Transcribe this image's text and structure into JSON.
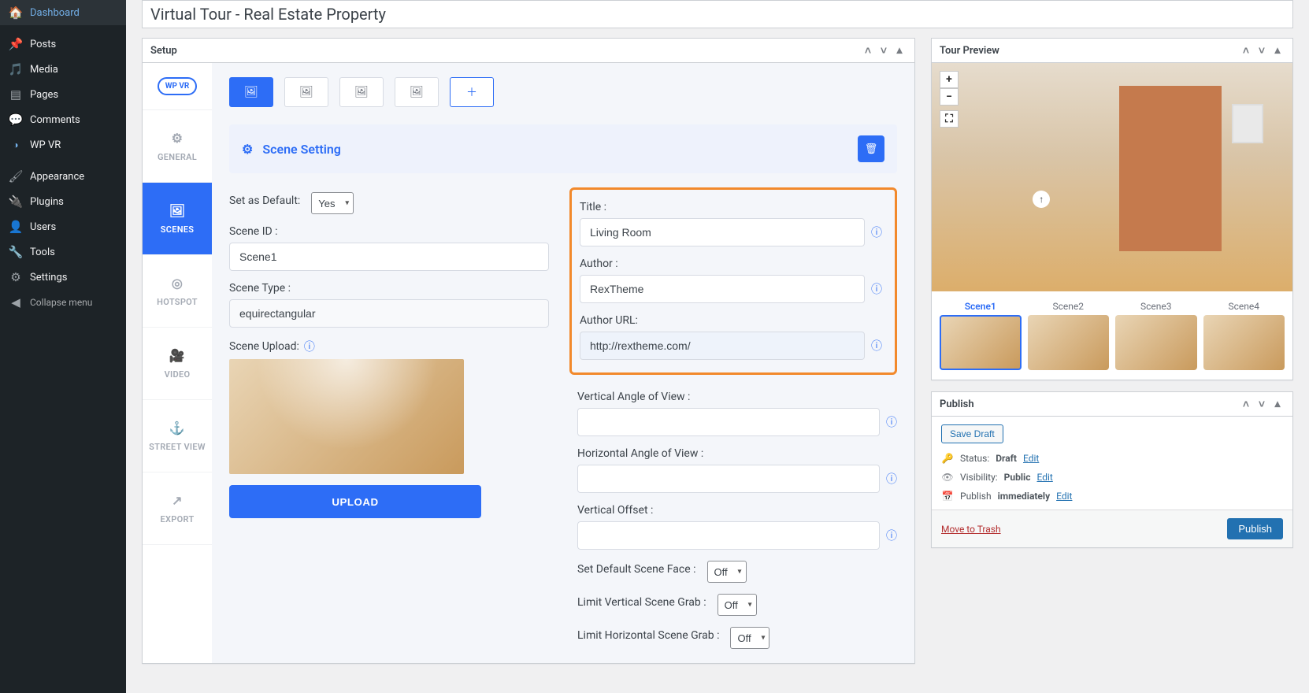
{
  "admin_menu": {
    "dashboard": "Dashboard",
    "posts": "Posts",
    "media": "Media",
    "pages": "Pages",
    "comments": "Comments",
    "wpvr": "WP VR",
    "appearance": "Appearance",
    "plugins": "Plugins",
    "users": "Users",
    "tools": "Tools",
    "settings": "Settings",
    "collapse": "Collapse menu"
  },
  "page_title": "Virtual Tour - Real Estate Property",
  "setup": {
    "title": "Setup",
    "logo": "WP VR",
    "nav": {
      "general": "GENERAL",
      "scenes": "SCENES",
      "hotspot": "HOTSPOT",
      "video": "VIDEO",
      "street_view": "STREET VIEW",
      "export": "EXPORT"
    },
    "scene_section_title": "Scene Setting",
    "left_fields": {
      "set_default_label": "Set as Default:",
      "set_default_value": "Yes",
      "scene_id_label": "Scene ID :",
      "scene_id_value": "Scene1",
      "scene_type_label": "Scene Type :",
      "scene_type_value": "equirectangular",
      "scene_upload_label": "Scene Upload:",
      "upload_btn": "UPLOAD"
    },
    "right_fields": {
      "title_label": "Title :",
      "title_value": "Living Room",
      "author_label": "Author :",
      "author_value": "RexTheme",
      "author_url_label": "Author URL:",
      "author_url_value": "http://rextheme.com/",
      "v_angle_label": "Vertical Angle of View :",
      "h_angle_label": "Horizontal Angle of View :",
      "v_offset_label": "Vertical Offset :",
      "default_face_label": "Set Default Scene Face :",
      "default_face_value": "Off",
      "limit_v_label": "Limit Vertical Scene Grab :",
      "limit_v_value": "Off",
      "limit_h_label": "Limit Horizontal Scene Grab :",
      "limit_h_value": "Off"
    }
  },
  "preview": {
    "title": "Tour Preview",
    "zoom_in": "+",
    "zoom_out": "−",
    "scenes": [
      "Scene1",
      "Scene2",
      "Scene3",
      "Scene4"
    ]
  },
  "publish": {
    "title": "Publish",
    "save_draft": "Save Draft",
    "status_label": "Status:",
    "status_value": "Draft",
    "visibility_label": "Visibility:",
    "visibility_value": "Public",
    "schedule_label": "Publish",
    "schedule_value": "immediately",
    "edit": "Edit",
    "trash": "Move to Trash",
    "publish_btn": "Publish"
  }
}
